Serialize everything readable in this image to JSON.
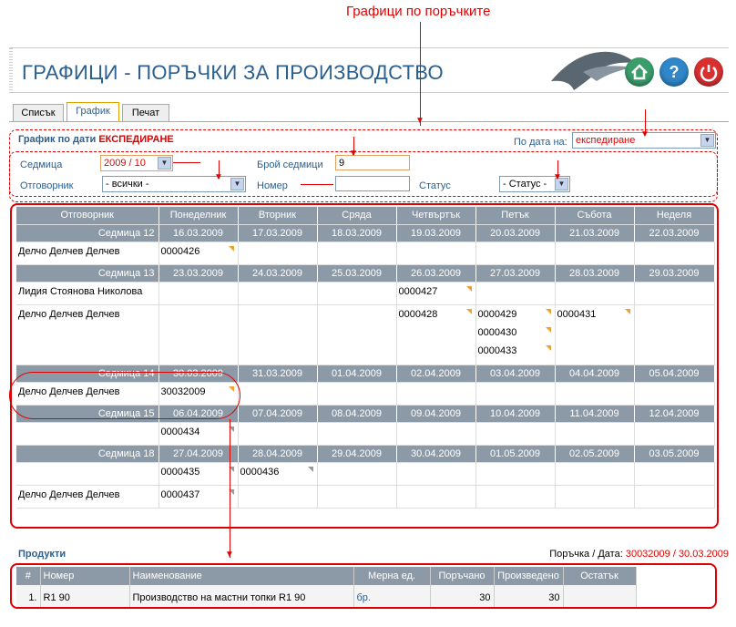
{
  "annotation": {
    "title": "Графици по поръчките"
  },
  "header": {
    "title": "ГРАФИЦИ - ПОРЪЧКИ ЗА ПРОИЗВОДСТВО",
    "buttons": [
      {
        "name": "home",
        "color": "#3a9d6a"
      },
      {
        "name": "help",
        "color": "#2f86c8",
        "glyph": "?"
      },
      {
        "name": "power",
        "color": "#d83030"
      }
    ]
  },
  "tabs": [
    "Списък",
    "График",
    "Печат"
  ],
  "filter": {
    "heading": "График по дати",
    "heading_status": "ЕКСПЕДИРАНЕ",
    "by_date_label": "По дата на:",
    "by_date_value": "експедиране",
    "week_label": "Седмица",
    "week_value": "2009 / 10",
    "weeks_count_label": "Брой седмици",
    "weeks_count_value": "9",
    "responsible_label": "Отговорник",
    "responsible_value": "- всички -",
    "number_label": "Номер",
    "number_value": "",
    "status_label": "Статус",
    "status_value": "- Статус -"
  },
  "grid": {
    "columns": [
      "Отговорник",
      "Понеделник",
      "Вторник",
      "Сряда",
      "Четвъртък",
      "Петък",
      "Събота",
      "Неделя"
    ],
    "weeks": [
      {
        "label": "Седмица 12",
        "dates": [
          "16.03.2009",
          "17.03.2009",
          "18.03.2009",
          "19.03.2009",
          "20.03.2009",
          "21.03.2009",
          "22.03.2009"
        ],
        "rows": [
          {
            "name": "Делчо Делчев Делчев",
            "cells": [
              [
                "0000426"
              ],
              [],
              [],
              [],
              [],
              [],
              []
            ]
          }
        ]
      },
      {
        "label": "Седмица 13",
        "dates": [
          "23.03.2009",
          "24.03.2009",
          "25.03.2009",
          "26.03.2009",
          "27.03.2009",
          "28.03.2009",
          "29.03.2009"
        ],
        "rows": [
          {
            "name": "Лидия Стоянова Николова",
            "cells": [
              [],
              [],
              [],
              [
                "0000427"
              ],
              [],
              [],
              []
            ]
          },
          {
            "name": "Делчо Делчев Делчев",
            "cells": [
              [],
              [],
              [],
              [
                "0000428"
              ],
              [
                "0000429",
                "0000430",
                "0000433"
              ],
              [
                "0000431"
              ],
              []
            ]
          }
        ]
      },
      {
        "label": "Седмица 14",
        "dates": [
          "30.03.2009",
          "31.03.2009",
          "01.04.2009",
          "02.04.2009",
          "03.04.2009",
          "04.04.2009",
          "05.04.2009"
        ],
        "rows": [
          {
            "name": "Делчо Делчев Делчев",
            "cells": [
              [
                "30032009"
              ],
              [],
              [],
              [],
              [],
              [],
              []
            ]
          }
        ]
      },
      {
        "label": "Седмица 15",
        "dates": [
          "06.04.2009",
          "07.04.2009",
          "08.04.2009",
          "09.04.2009",
          "10.04.2009",
          "11.04.2009",
          "12.04.2009"
        ],
        "rows": [
          {
            "name": "",
            "cells": [
              [
                "0000434"
              ],
              [],
              [],
              [],
              [],
              [],
              []
            ]
          }
        ]
      },
      {
        "label": "Седмица 18",
        "dates": [
          "27.04.2009",
          "28.04.2009",
          "29.04.2009",
          "30.04.2009",
          "01.05.2009",
          "02.05.2009",
          "03.05.2009"
        ],
        "rows": [
          {
            "name": "",
            "cells": [
              [
                "0000435"
              ],
              [
                "0000436"
              ],
              [],
              [],
              [],
              [],
              []
            ]
          },
          {
            "name": "Делчо Делчев Делчев",
            "cells": [
              [
                "0000437"
              ],
              [],
              [],
              [],
              [],
              [],
              []
            ]
          }
        ]
      }
    ]
  },
  "products": {
    "heading": "Продукти",
    "order_label": "Поръчка / Дата:",
    "order_value": "30032009 / 30.03.2009",
    "columns": [
      "#",
      "Номер",
      "Наименование",
      "Мерна ед.",
      "Поръчано",
      "Произведено",
      "Остатък"
    ],
    "rows": [
      {
        "idx": "1.",
        "number": "R1 90",
        "name": "Производство на мастни топки R1 90",
        "unit": "бр.",
        "ordered": "30",
        "produced": "30",
        "remaining": ""
      }
    ]
  }
}
